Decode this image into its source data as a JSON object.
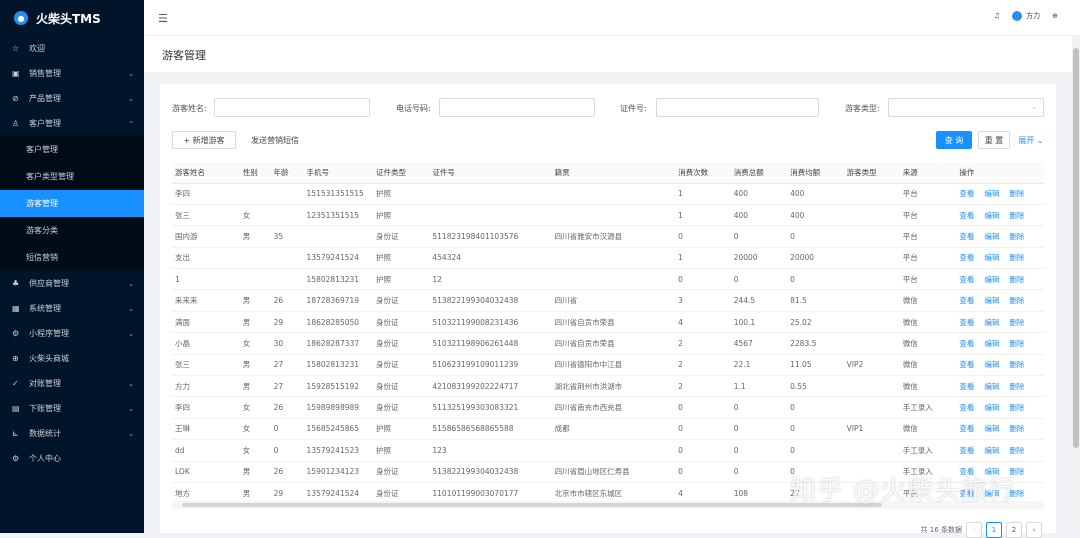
{
  "app": {
    "title": "火柴头TMS"
  },
  "sidebar": {
    "items": [
      {
        "label": "欢迎",
        "icon": "☆",
        "icon_name": "star-icon",
        "chevron": ""
      },
      {
        "label": "销售管理",
        "icon": "▣",
        "icon_name": "sales-icon",
        "chevron": "⌄"
      },
      {
        "label": "产品管理",
        "icon": "⊘",
        "icon_name": "product-icon",
        "chevron": "⌄"
      },
      {
        "label": "客户管理",
        "icon": "♙",
        "icon_name": "customer-icon",
        "chevron": "⌃"
      }
    ],
    "sub_items": [
      {
        "label": "客户管理"
      },
      {
        "label": "客户类型管理"
      },
      {
        "label": "游客管理"
      },
      {
        "label": "游客分类"
      },
      {
        "label": "短信营销"
      }
    ],
    "bottom_items": [
      {
        "label": "供应商管理",
        "icon": "♣",
        "icon_name": "supplier-icon",
        "chevron": "⌄"
      },
      {
        "label": "系统管理",
        "icon": "▦",
        "icon_name": "system-icon",
        "chevron": "⌄"
      },
      {
        "label": "小程序管理",
        "icon": "⚙",
        "icon_name": "miniprogram-icon",
        "chevron": "⌄"
      },
      {
        "label": "火柴头商城",
        "icon": "⊕",
        "icon_name": "mall-icon",
        "chevron": ""
      },
      {
        "label": "对账管理",
        "icon": "✓",
        "icon_name": "reconcile-icon",
        "chevron": "⌄"
      },
      {
        "label": "下账管理",
        "icon": "▤",
        "icon_name": "bookkeeping-icon",
        "chevron": "⌄"
      },
      {
        "label": "数据统计",
        "icon": "⊾",
        "icon_name": "statistics-icon",
        "chevron": "⌄"
      },
      {
        "label": "个人中心",
        "icon": "⚙",
        "icon_name": "personal-icon",
        "chevron": ""
      }
    ]
  },
  "topbar": {
    "user": "方力"
  },
  "page": {
    "title": "游客管理"
  },
  "filters": {
    "name_label": "游客姓名:",
    "phone_label": "电话号码:",
    "id_label": "证件号:",
    "type_label": "游客类型:"
  },
  "actions": {
    "add": "+ 新增游客",
    "sms": "发送营销短信",
    "search": "查 询",
    "reset": "重 置",
    "expand": "展开 ⌄"
  },
  "table": {
    "headers": [
      "游客姓名",
      "性别",
      "年龄",
      "手机号",
      "证件类型",
      "证件号",
      "籍贯",
      "消费次数",
      "消费总额",
      "消费均额",
      "游客类型",
      "来源",
      "操作"
    ],
    "ops": [
      "查看",
      "编辑",
      "删除"
    ],
    "rows": [
      [
        "李四",
        "",
        "",
        "151531351515",
        "护照",
        "",
        "",
        "1",
        "400",
        "400",
        "",
        "平台"
      ],
      [
        "张三",
        "女",
        "",
        "12351351515",
        "护照",
        "",
        "",
        "1",
        "400",
        "400",
        "",
        "平台"
      ],
      [
        "国内游",
        "男",
        "35",
        "",
        "身份证",
        "511823198401103576",
        "四川省雅安市汉源县",
        "0",
        "0",
        "0",
        "",
        "平台"
      ],
      [
        "支出",
        "",
        "",
        "13579241524",
        "护照",
        "454324",
        "",
        "1",
        "20000",
        "20000",
        "",
        "平台"
      ],
      [
        "1",
        "",
        "",
        "15802813231",
        "护照",
        "12",
        "",
        "0",
        "0",
        "0",
        "",
        "平台"
      ],
      [
        "来来来",
        "男",
        "26",
        "18728369719",
        "身份证",
        "513822199304032438",
        "四川省",
        "3",
        "244.5",
        "81.5",
        "",
        "微信"
      ],
      [
        "满面",
        "男",
        "29",
        "18628285050",
        "身份证",
        "510321199008231436",
        "四川省自贡市荣县",
        "4",
        "100.1",
        "25.02",
        "",
        "微信"
      ],
      [
        "小晶",
        "女",
        "30",
        "18628287337",
        "身份证",
        "510321198906261448",
        "四川省自贡市荣县",
        "2",
        "4567",
        "2283.5",
        "",
        "微信"
      ],
      [
        "张三",
        "男",
        "27",
        "15802813231",
        "身份证",
        "510623199109011239",
        "四川省德阳市中江县",
        "2",
        "22.1",
        "11.05",
        "VIP2",
        "微信"
      ],
      [
        "方力",
        "男",
        "27",
        "15928515192",
        "身份证",
        "421083199202224717",
        "湖北省荆州市洪湖市",
        "2",
        "1.1",
        "0.55",
        "",
        "微信"
      ],
      [
        "李四",
        "女",
        "26",
        "15989898989",
        "身份证",
        "511325199303083321",
        "四川省南充市西充县",
        "0",
        "0",
        "0",
        "",
        "手工录入"
      ],
      [
        "王琳",
        "女",
        "0",
        "15685245865",
        "护照",
        "51586586568865588",
        "成都",
        "0",
        "0",
        "0",
        "VIP1",
        "微信"
      ],
      [
        "dd",
        "女",
        "0",
        "13579241523",
        "护照",
        "123",
        "",
        "0",
        "0",
        "0",
        "",
        "手工录入"
      ],
      [
        "LOK",
        "男",
        "26",
        "15901234123",
        "身份证",
        "513822199304032438",
        "四川省眉山地区仁寿县",
        "0",
        "0",
        "0",
        "",
        "手工录入"
      ],
      [
        "地方",
        "男",
        "29",
        "13579241524",
        "身份证",
        "110101199003070177",
        "北京市市辖区东城区",
        "4",
        "108",
        "27",
        "",
        "平台"
      ]
    ]
  },
  "pagination": {
    "total": "共 16 条数据",
    "prev": "‹",
    "pages": [
      "1",
      "2"
    ],
    "next": "›"
  },
  "watermark": "知乎 @火柴头旅行"
}
